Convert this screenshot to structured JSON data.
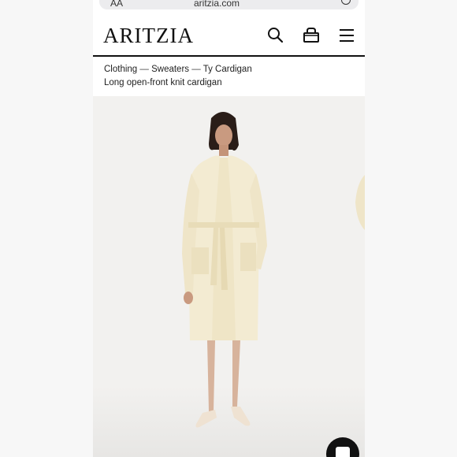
{
  "browser": {
    "aa_label": "AA",
    "url": "aritzia.com"
  },
  "header": {
    "logo": "ARITZIA"
  },
  "icons": {
    "search": "search-icon",
    "bag": "shopping-bag-icon",
    "menu": "hamburger-menu-icon",
    "chat": "chat-icon"
  },
  "breadcrumb": {
    "items": [
      "Clothing",
      "Sweaters",
      "Ty Cardigan"
    ],
    "separator": " — "
  },
  "product": {
    "subtitle": "Long open-front knit cardigan",
    "image_alt": "Model wearing a cream long open-front knit cardigan with belt"
  },
  "colors": {
    "cardigan": "#f3ebd2",
    "background": "#f2f1ef"
  }
}
